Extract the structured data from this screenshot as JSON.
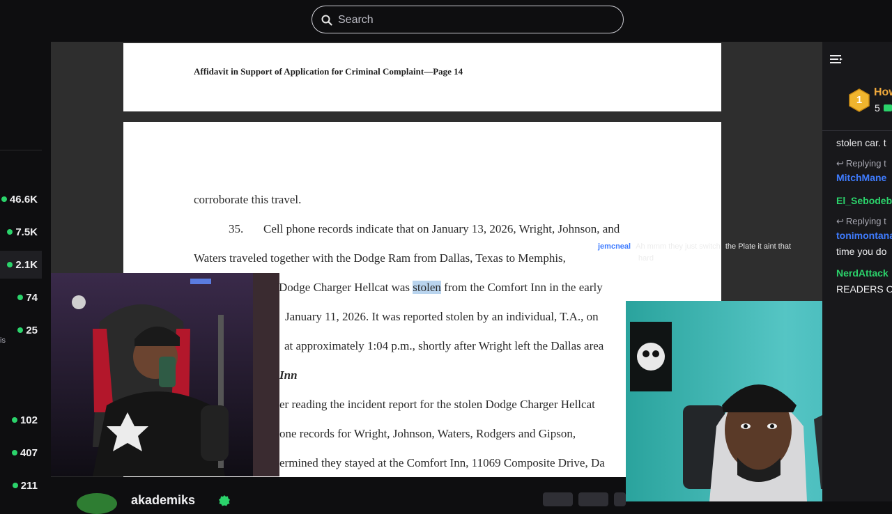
{
  "search": {
    "placeholder": "Search"
  },
  "rail": {
    "counts": [
      "46.6K",
      "7.5K",
      "2.1K",
      "74",
      "25",
      "102",
      "407",
      "211"
    ],
    "fragment": "is"
  },
  "document": {
    "page_header": "Affidavit in Support of Application for Criminal Complaint—Page 14",
    "line1": "corroborate this travel.",
    "para_num": "35.",
    "line2": "Cell phone records indicate that on January 13, 2026, Wright, Johnson, and",
    "line3": "Waters traveled together with the Dodge Ram from Dallas, Texas to Memphis,",
    "line4_pre": "Dodge Charger Hellcat was ",
    "line4_hl": "stolen",
    "line4_post": " from the Comfort Inn in the early",
    "line5": "January 11, 2026. It was reported stolen by an individual, T.A., on",
    "line6": "at approximately 1:04 p.m., shortly after Wright left the Dallas area",
    "line7": "Inn",
    "line8": "er reading the incident report for the stolen Dodge Charger Hellcat",
    "line9": "one records for Wright, Johnson, Waters, Rodgers and Gipson,",
    "line10": "ermined they stayed at the Comfort Inn, 11069 Composite Drive, Da"
  },
  "overlay_chat": {
    "user": "jemcneal",
    "message_faint": "Ah mmm they just switch",
    "message": "the Plate it aint that",
    "message_2": "hard"
  },
  "sidebar": {
    "rank": "1",
    "hype_title": "How",
    "hype_count": "5",
    "chat": [
      {
        "type": "text",
        "text": "stolen car. t"
      },
      {
        "type": "reply",
        "text": "Replying t"
      },
      {
        "type": "user",
        "text": "MitchMane",
        "color": "#3f7cff"
      },
      {
        "type": "user",
        "text": "El_Sebodeb",
        "color": "#2bd36b"
      },
      {
        "type": "reply",
        "text": "Replying t"
      },
      {
        "type": "user",
        "text": "tonimontana",
        "color": "#3f7cff"
      },
      {
        "type": "text",
        "text": "time you do"
      },
      {
        "type": "user",
        "text": "NerdAttack",
        "color": "#2bd36b"
      },
      {
        "type": "text",
        "text": "READERS O"
      }
    ]
  },
  "channel": {
    "name": "akademiks"
  },
  "colors": {
    "accent_green": "#2bd36b",
    "link_blue": "#3f7cff",
    "highlight": "#b9d4ee"
  }
}
